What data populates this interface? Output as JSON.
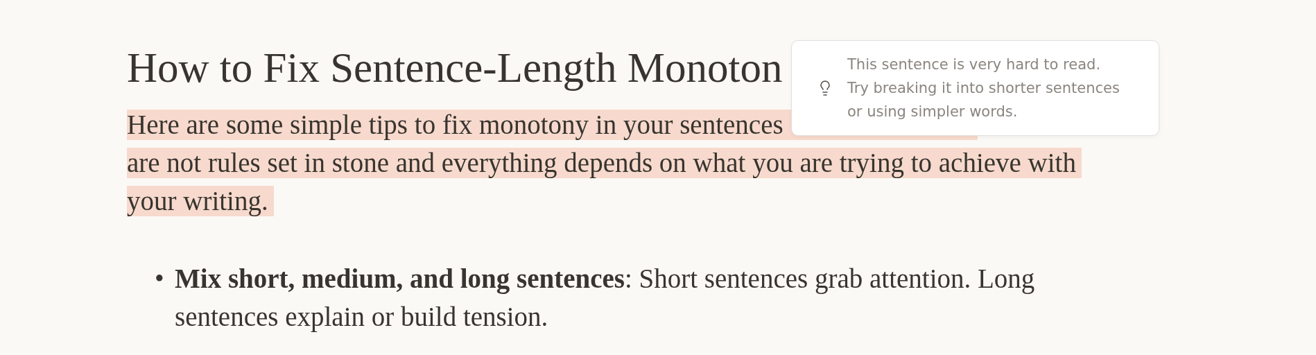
{
  "heading": "How to Fix Sentence-Length Monoton",
  "paragraph": {
    "highlighted": true,
    "lines": [
      "Here are some simple tips to fix monotony in your sentences",
      "are not rules set in stone and everything depends on what you are trying to achieve with",
      "your writing."
    ]
  },
  "list": [
    {
      "bullet": "•",
      "text": "**Mix short, medium, and long sentences**: Short sentences grab attention. Long sentences explain or build tension."
    }
  ],
  "tooltip": {
    "lines": [
      "This sentence is very hard to read.",
      "Try breaking it into shorter sentences",
      "or using simpler words."
    ]
  }
}
